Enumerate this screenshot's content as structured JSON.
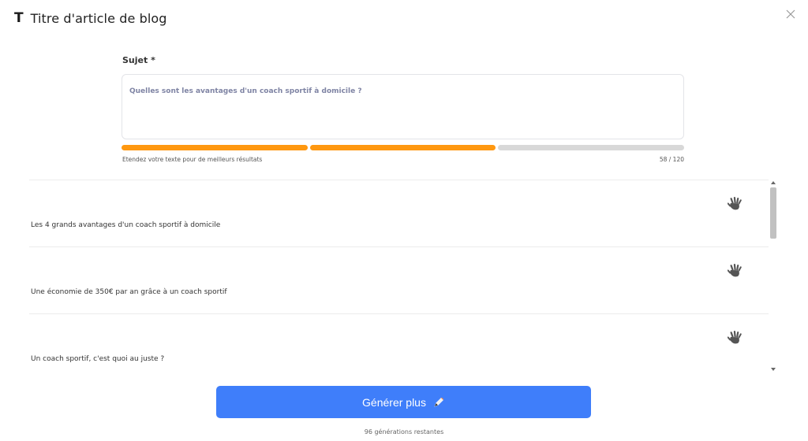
{
  "header": {
    "icon_glyph": "T",
    "title": "Titre d'article de blog"
  },
  "form": {
    "subject_label": "Sujet *",
    "subject_value": "Quelles sont les avantages d'un coach sportif à domicile ?",
    "progress": {
      "filled_segments": 2,
      "total_segments": 3,
      "accent_color": "#ff9810"
    },
    "hint": "Etendez votre texte pour de meilleurs résultats",
    "char_count": "58 / 120"
  },
  "results": [
    {
      "text": "Les 4 grands avantages d'un coach sportif à domicile",
      "icon": "hand-icon"
    },
    {
      "text": "Une économie de 350€ par an grâce à un coach sportif",
      "icon": "hand-icon"
    },
    {
      "text": "Un coach sportif, c'est quoi au juste ?",
      "icon": "hand-icon"
    }
  ],
  "actions": {
    "generate_label": "Générer plus",
    "generate_icon": "pen-icon",
    "button_color": "#3f7efa",
    "remaining": "96 générations restantes"
  },
  "icons": {
    "close": "close-icon"
  }
}
